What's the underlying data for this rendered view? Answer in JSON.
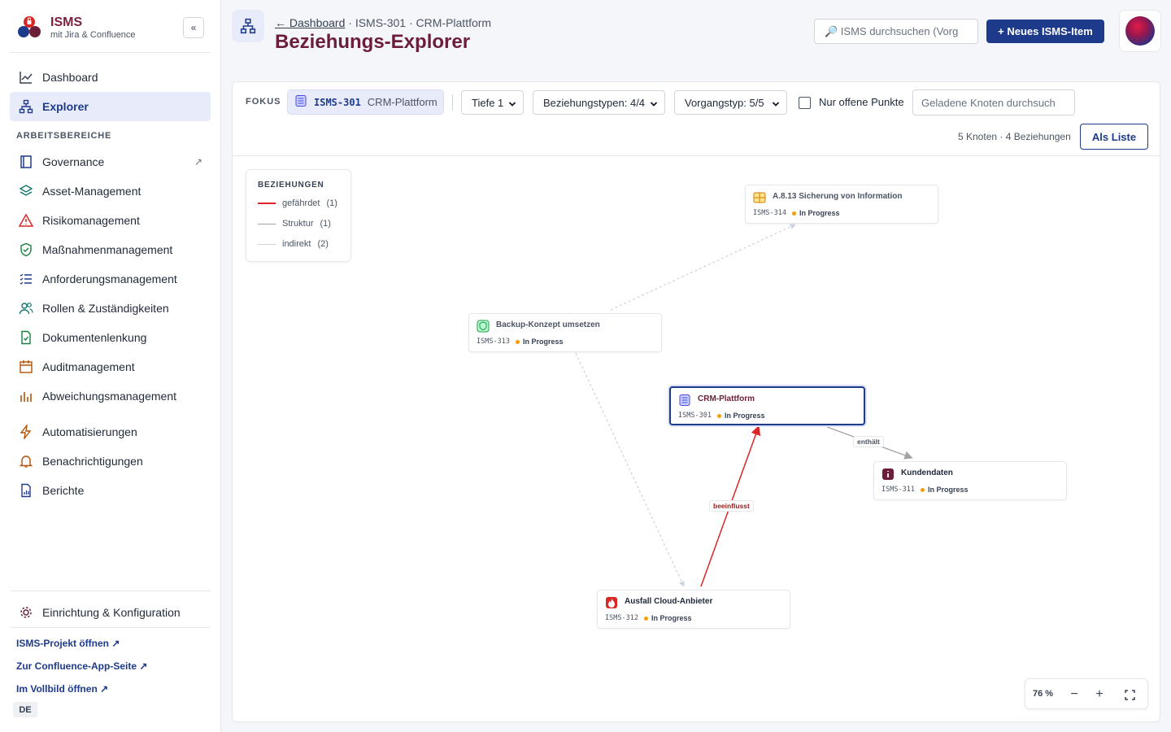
{
  "brand": {
    "title": "ISMS",
    "subtitle": "mit Jira & Confluence",
    "collapse": "«"
  },
  "nav": {
    "dashboard": "Dashboard",
    "explorer": "Explorer",
    "section": "ARBEITSBEREICHE",
    "governance": "Governance",
    "governance_ext": "↗",
    "asset": "Asset-Management",
    "risiko": "Risikomanagement",
    "massnahmen": "Maßnahmenmanagement",
    "anforderungen": "Anforderungsmanagement",
    "rollen": "Rollen & Zuständigkeiten",
    "dokumente": "Dokumentenlenkung",
    "audit": "Auditmanagement",
    "abweichung": "Abweichungsmanagement",
    "automatisierung": "Automatisierungen",
    "benachrichtigung": "Benachrichtigungen",
    "berichte": "Berichte",
    "einrichtung": "Einrichtung & Konfiguration"
  },
  "footer": {
    "projekt": "ISMS-Projekt öffnen ↗",
    "confluence": "Zur Confluence-App-Seite ↗",
    "vollbild": "Im Vollbild öffnen ↗",
    "lang": "DE"
  },
  "header": {
    "back": "← Dashboard",
    "crumb_rest": " · ISMS-301 · CRM-Plattform",
    "title": "Beziehungs-Explorer",
    "search_placeholder": "🔎 ISMS durchsuchen (Vorg",
    "new_button": "+ Neues ISMS-Item"
  },
  "toolbar": {
    "fokus_label": "FOKUS",
    "fokus_key": "ISMS-301",
    "fokus_name": "CRM-Plattform",
    "depth": "Tiefe 1",
    "relation_types": "Beziehungstypen: 4/4",
    "issue_types": "Vorgangstyp: 5/5",
    "open_only": "Nur offene Punkte",
    "filter_placeholder": "Geladene Knoten durchsuch",
    "stats": "5 Knoten · 4 Beziehungen",
    "list_button": "Als Liste"
  },
  "legend": {
    "title": "BEZIEHUNGEN",
    "items": [
      {
        "label": "gefährdet",
        "count": "(1)",
        "color": "#dc2626"
      },
      {
        "label": "Struktur",
        "count": "(1)",
        "color": "#9ca3af"
      },
      {
        "label": "indirekt",
        "count": "(2)",
        "color": "#d1d5db"
      }
    ]
  },
  "nodes": [
    {
      "title": "A.8.13 Sicherung von Information",
      "key": "ISMS-314",
      "status": "In Progress",
      "icon": "control-icon"
    },
    {
      "title": "Backup-Konzept umsetzen",
      "key": "ISMS-313",
      "status": "In Progress",
      "icon": "measure-icon"
    },
    {
      "title": "CRM-Plattform",
      "key": "ISMS-301",
      "status": "In Progress",
      "icon": "asset-icon"
    },
    {
      "title": "Kundendaten",
      "key": "ISMS-311",
      "status": "In Progress",
      "icon": "info-icon"
    },
    {
      "title": "Ausfall Cloud-Anbieter",
      "key": "ISMS-312",
      "status": "In Progress",
      "icon": "threat-icon"
    }
  ],
  "edges": {
    "enthaelt": "enthält",
    "beeinflusst": "beeinflusst"
  },
  "zoom": {
    "percent": "76 %",
    "minus": "−",
    "plus": "+"
  }
}
